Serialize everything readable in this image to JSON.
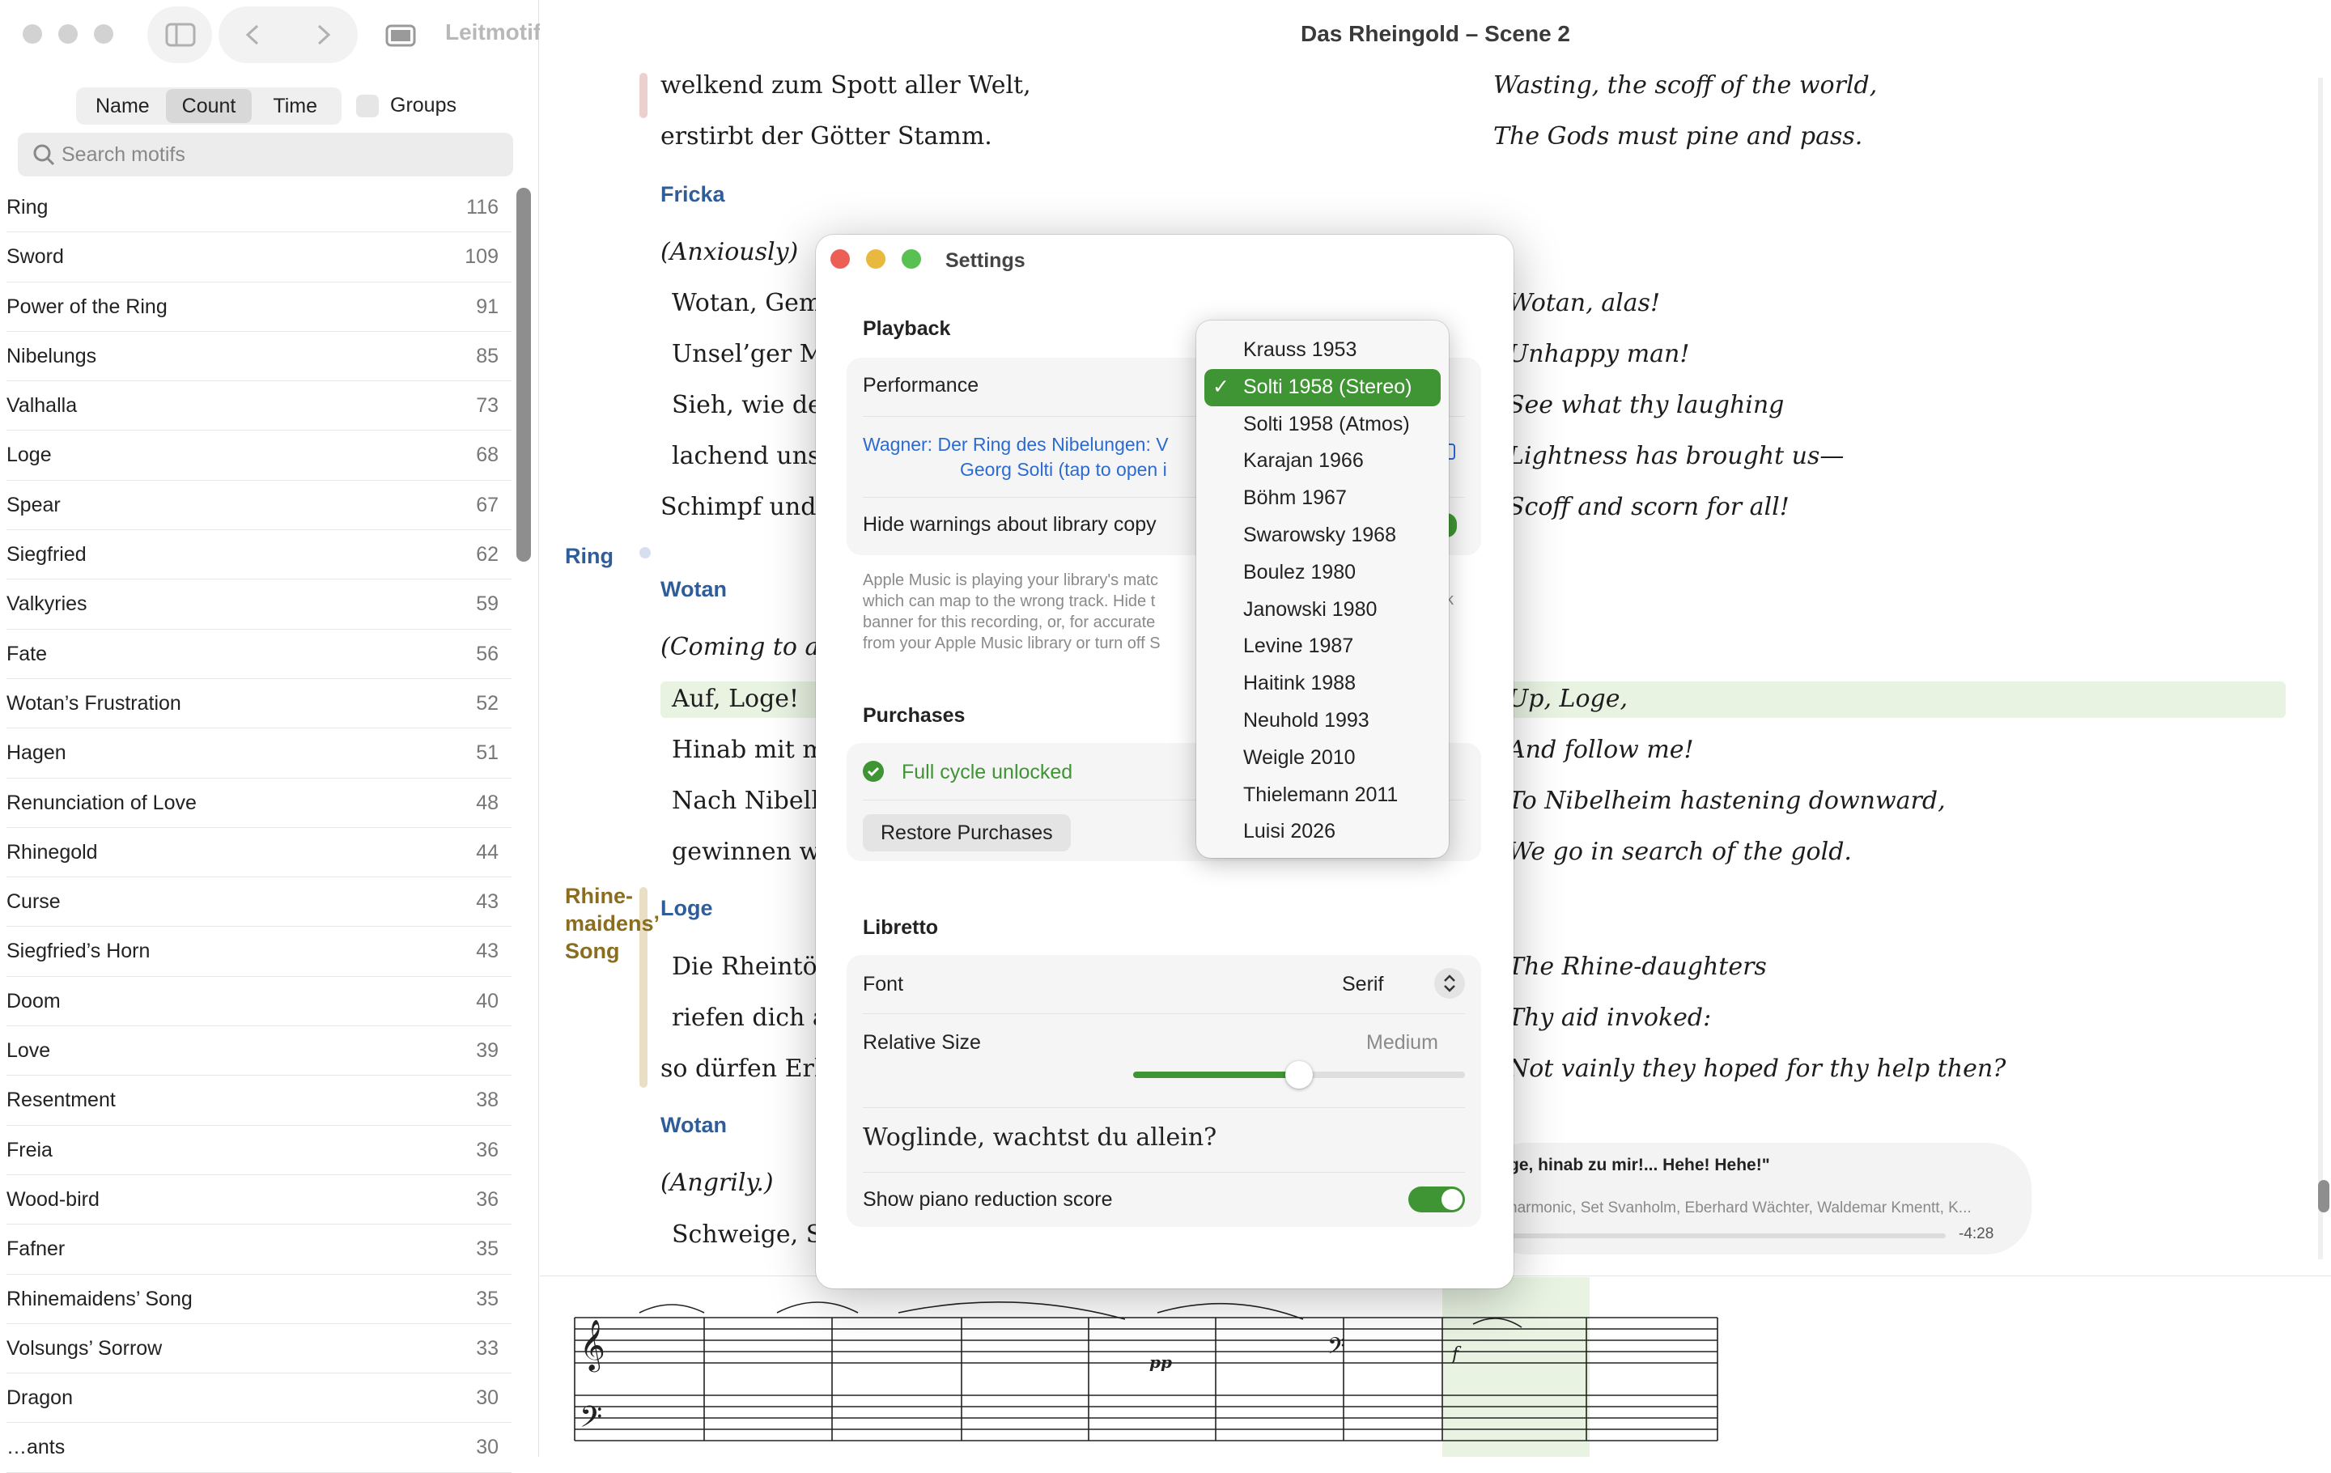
{
  "sidebar": {
    "app_title": "Leitmotifs",
    "sort_options": [
      "Name",
      "Count",
      "Time"
    ],
    "groups_label": "Groups",
    "search_placeholder": "Search motifs",
    "motifs": [
      {
        "name": "Ring",
        "count": "116"
      },
      {
        "name": "Sword",
        "count": "109"
      },
      {
        "name": "Power of the Ring",
        "count": "91"
      },
      {
        "name": "Nibelungs",
        "count": "85"
      },
      {
        "name": "Valhalla",
        "count": "73"
      },
      {
        "name": "Loge",
        "count": "68"
      },
      {
        "name": "Spear",
        "count": "67"
      },
      {
        "name": "Siegfried",
        "count": "62"
      },
      {
        "name": "Valkyries",
        "count": "59"
      },
      {
        "name": "Fate",
        "count": "56"
      },
      {
        "name": "Wotan’s Frustration",
        "count": "52"
      },
      {
        "name": "Hagen",
        "count": "51"
      },
      {
        "name": "Renunciation of Love",
        "count": "48"
      },
      {
        "name": "Rhinegold",
        "count": "44"
      },
      {
        "name": "Curse",
        "count": "43"
      },
      {
        "name": "Siegfried’s Horn",
        "count": "43"
      },
      {
        "name": "Doom",
        "count": "40"
      },
      {
        "name": "Love",
        "count": "39"
      },
      {
        "name": "Resentment",
        "count": "38"
      },
      {
        "name": "Freia",
        "count": "36"
      },
      {
        "name": "Wood-bird",
        "count": "36"
      },
      {
        "name": "Fafner",
        "count": "35"
      },
      {
        "name": "Rhinemaidens’ Song",
        "count": "35"
      },
      {
        "name": "Volsungs’ Sorrow",
        "count": "33"
      },
      {
        "name": "Dragon",
        "count": "30"
      },
      {
        "name": "…ants",
        "count": "30"
      }
    ]
  },
  "document": {
    "title": "Das Rheingold – Scene 2",
    "motif_ring": "Ring",
    "motif_rhinemaidens": [
      "Rhine-",
      "maidens’",
      "Song"
    ],
    "g1": "welkend zum Spott aller Welt,",
    "g2": "erstirbt der Götter Stamm.",
    "e1": "Wasting, the scoff of the world,",
    "e2": "The Gods must pine and pass.",
    "sp_fricka": "Fricka",
    "dir1": "(Anxiously)",
    "g3": "Wotan, Gem",
    "g4": "Unsel’ger Ma",
    "g5": "Sieh, wie dei",
    "g6": "lachend uns",
    "g7": "Schimpf und S",
    "e3": "Wotan, alas!",
    "e4": "Unhappy man!",
    "e5": "See what thy laughing",
    "e6": "Lightness has brought us—",
    "e7": "Scoff and scorn for all!",
    "sp_wotan1": "Wotan",
    "dir2": "(Coming to a s",
    "g8": "Auf, Loge!",
    "g9": "Hinab mit m",
    "g10": "Nach Nibelh",
    "g11": "gewinnen wi",
    "e8": "Up, Loge,",
    "e9": "And follow me!",
    "e10": "To Nibelheim hastening downward,",
    "e11": "We go in search of the gold.",
    "sp_loge": "Loge",
    "g12": "Die Rheintöc",
    "g13": "riefen dich a",
    "g14": "so dürfen Erh",
    "e12": "The Rhine-daughters",
    "e13": "Thy aid invoked:",
    "e14": "Not vainly they hoped for thy help then?",
    "sp_wotan2": "Wotan",
    "dir3": "(Angrily.)",
    "g15": "Schweige, Sc"
  },
  "player": {
    "track": "ge, hinab zu mir!... Hehe! Hehe!\"",
    "artists": "harmonic, Set Svanholm, Eberhard Wächter, Waldemar Kmentt, K...",
    "remaining": "-4:28"
  },
  "settings": {
    "title": "Settings",
    "playback_header": "Playback",
    "performance_label": "Performance",
    "link_line1": "Wagner: Der Ring des Nibelungen: V",
    "link_line2": "Georg Solti (tap to open i",
    "hide_warnings_label": "Hide warnings about library copy",
    "note_line1": "Apple Music is playing your library's matc",
    "note_line2": "which can map to the wrong track. Hide t",
    "note_line3": "banner for this recording, or, for accurate",
    "note_line4": "from your Apple Music library or turn off S",
    "note_tail": "k",
    "purchases_header": "Purchases",
    "full_cycle": "Full cycle unlocked",
    "restore_button": "Restore Purchases",
    "libretto_header": "Libretto",
    "font_label": "Font",
    "font_value": "Serif",
    "relative_size_label": "Relative Size",
    "relative_size_value": "Medium",
    "relative_size_level": 0.5,
    "sample_text": "Woglinde, wachtst du allein?",
    "piano_label": "Show piano reduction score",
    "piano_on": true,
    "hide_warnings_on": true
  },
  "performance_popup": {
    "options": [
      "Krauss 1953",
      "Solti 1958 (Stereo)",
      "Solti 1958 (Atmos)",
      "Karajan 1966",
      "Böhm 1967",
      "Swarowsky 1968",
      "Boulez 1980",
      "Janowski 1980",
      "Levine 1987",
      "Haitink 1988",
      "Neuhold 1993",
      "Weigle 2010",
      "Thielemann 2011",
      "Luisi 2026"
    ],
    "selected_index": 1
  },
  "colors": {
    "accent_green": "#3f9433",
    "speaker_blue": "#2f5d9a",
    "motif_gold": "#8a6d1f",
    "link_blue": "#2b6bd1"
  }
}
